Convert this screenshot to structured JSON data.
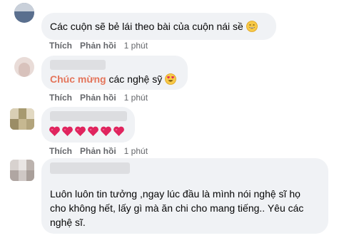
{
  "comments": [
    {
      "text": "Các cuộn sẽ bẻ lái theo bài của cuộn nái sề",
      "emoji_icon": "grinning-face-icon",
      "actions": {
        "like": "Thích",
        "reply": "Phản hồi",
        "time": "1 phút"
      }
    },
    {
      "highlight_text": "Chúc mừng",
      "text": " các nghệ sỹ",
      "emoji_icon": "heart-eyes-face-icon",
      "actions": {
        "like": "Thích",
        "reply": "Phản hồi",
        "time": "1 phút"
      }
    },
    {
      "hearts_icon": "red-heart-icon",
      "hearts_count": 6,
      "actions": {
        "like": "Thích",
        "reply": "Phản hồi",
        "time": "1 phút"
      }
    },
    {
      "lines": [
        "Luôn luôn tin tưởng ,ngay lúc đầu là mình nói nghệ sĩ họ",
        "cho không hết, lấy gì mà ăn chi cho mang tiếng.. Yêu các",
        "nghệ sĩ."
      ]
    }
  ],
  "colors": {
    "bubble": "#f0f2f5",
    "meta": "#65676b",
    "highlight": "#e4755b",
    "heart": "#e0245e"
  }
}
